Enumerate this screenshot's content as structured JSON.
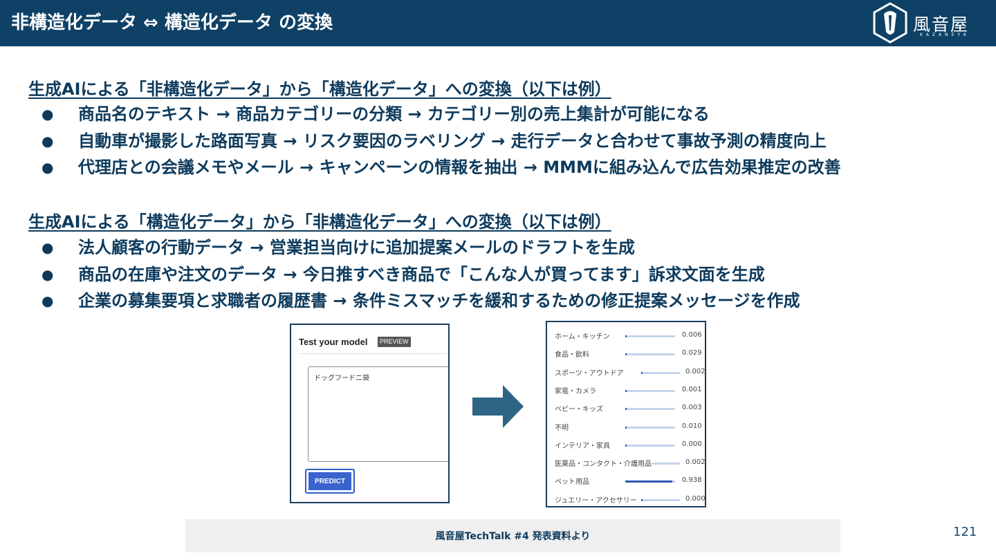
{
  "header": {
    "title": "非構造化データ ⇔ 構造化データ の変換",
    "logo_text": "風音屋",
    "logo_sub": "KAZANEYA"
  },
  "sections": [
    {
      "heading": "生成AIによる「非構造化データ」から「構造化データ」への変換（以下は例）",
      "bullets": [
        "商品名のテキスト → 商品カテゴリーの分類 → カテゴリー別の売上集計が可能になる",
        "自動車が撮影した路面写真 → リスク要因のラベリング → 走行データと合わせて事故予測の精度向上",
        "代理店との会議メモやメール → キャンペーンの情報を抽出 → MMMに組み込んで広告効果推定の改善"
      ]
    },
    {
      "heading": "生成AIによる「構造化データ」から「非構造化データ」への変換（以下は例）",
      "bullets": [
        "法人顧客の行動データ → 営業担当向けに追加提案メールのドラフトを生成",
        "商品の在庫や注文のデータ → 今日推すべき商品で「こんな人が買ってます」訴求文面を生成",
        "企業の募集要項と求職者の履歴書 → 条件ミスマッチを緩和するための修正提案メッセージを作成"
      ]
    }
  ],
  "bullet_glyph": "●",
  "model_panel": {
    "title": "Test your model",
    "badge": "PREVIEW",
    "input_text": "ドッグフードニ袋",
    "predict_label": "PREDICT"
  },
  "predictions": [
    {
      "label": "ホーム・キッチン",
      "score": "0.006",
      "value": 0.006
    },
    {
      "label": "食品・飲料",
      "score": "0.029",
      "value": 0.029
    },
    {
      "label": "スポーツ・アウトドア",
      "score": "0.002",
      "value": 0.002
    },
    {
      "label": "家電・カメラ",
      "score": "0.001",
      "value": 0.001
    },
    {
      "label": "ベビー・キッズ",
      "score": "0.003",
      "value": 0.003
    },
    {
      "label": "不明",
      "score": "0.010",
      "value": 0.01
    },
    {
      "label": "インテリア・家具",
      "score": "0.000",
      "value": 0.0
    },
    {
      "label": "医薬品・コンタクト・介護用品",
      "score": "0.002",
      "value": 0.002
    },
    {
      "label": "ペット用品",
      "score": "0.938",
      "value": 0.938
    },
    {
      "label": "ジュエリー・アクセサリー",
      "score": "0.000",
      "value": 0.0
    }
  ],
  "footer": {
    "caption": "風音屋TechTalk #4 発表資料より",
    "page_number": "121"
  },
  "colors": {
    "header_bg": "#0f4166",
    "text": "#0d3a5c",
    "arrow": "#2e6585",
    "bar_fill": "#2f57b0",
    "bar_track": "#c5d4ea"
  }
}
